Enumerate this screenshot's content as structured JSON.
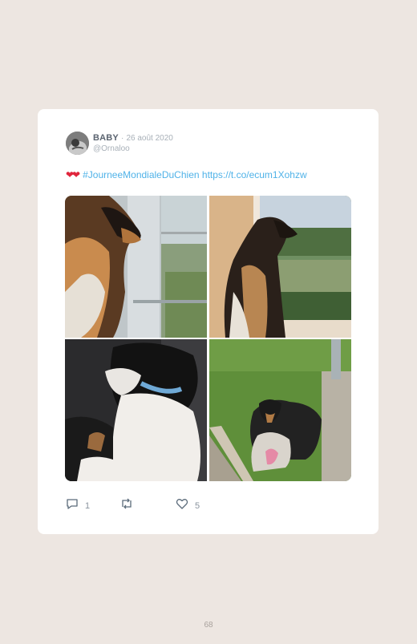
{
  "tweet": {
    "author_name": "BABY",
    "separator": "·",
    "date": "26 août 2020",
    "handle": "@Ornaloo",
    "emoji": "❤❤",
    "hashtag": "#JourneeMondialeDuChien",
    "link": "https://t.co/ecum1Xohzw"
  },
  "photos": [
    {
      "id": "photo-1",
      "description": "dog by window close-up"
    },
    {
      "id": "photo-2",
      "description": "dog sitting at window"
    },
    {
      "id": "photo-3",
      "description": "puppy with blue collar"
    },
    {
      "id": "photo-4",
      "description": "dog lying on grass"
    }
  ],
  "actions": {
    "reply_count": "1",
    "retweet_count": "",
    "like_count": "5"
  },
  "page": {
    "number": "68"
  },
  "colors": {
    "background": "#ede6e1",
    "card": "#ffffff",
    "link": "#4fb2e8",
    "heart": "#e0253c"
  },
  "icons": [
    "avatar",
    "reply-icon",
    "retweet-icon",
    "like-icon"
  ]
}
